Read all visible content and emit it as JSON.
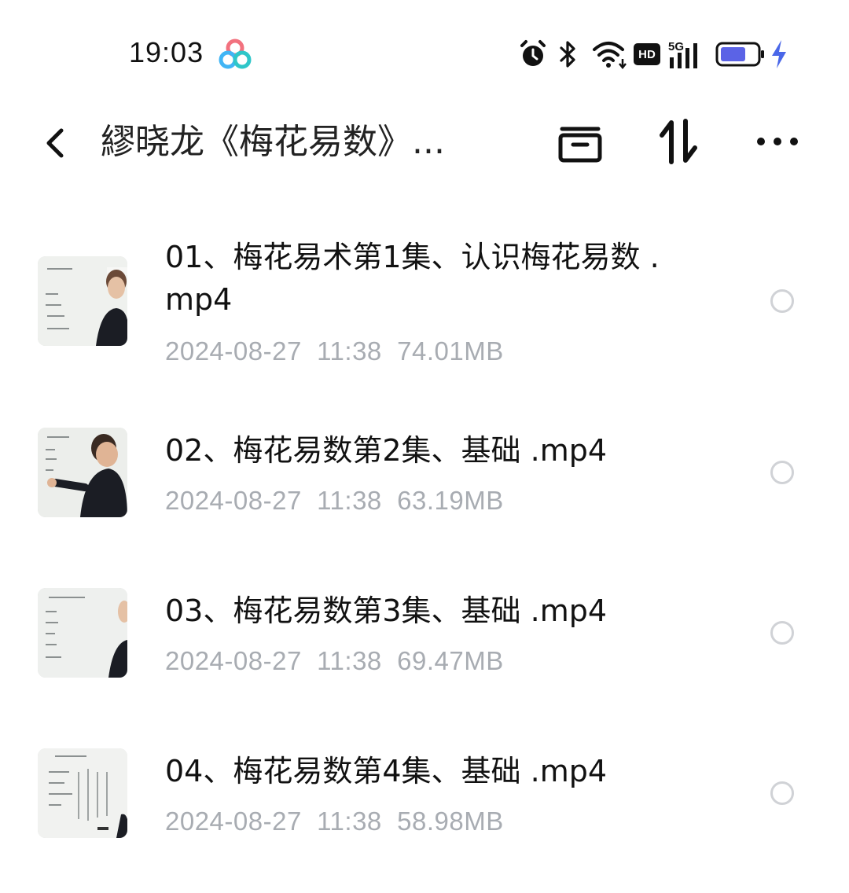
{
  "status_bar": {
    "time": "19:03",
    "hd_label": "HD",
    "network_label": "5G",
    "battery_level": 0.7,
    "icons": [
      "baidu-netdisk-logo",
      "alarm-icon",
      "bluetooth-icon",
      "wifi-icon",
      "hd-icon",
      "signal-5g-icon",
      "battery-icon",
      "charging-icon"
    ]
  },
  "header": {
    "title": "繆晓龙《梅花易数》...",
    "icons": [
      "back-chevron-icon",
      "archive-icon",
      "sort-icon",
      "more-icon"
    ]
  },
  "files": [
    {
      "name": "01、梅花易术第1集、认识梅花易数 .mp4",
      "date": "2024-08-27",
      "time": "11:38",
      "size": "74.01MB",
      "selected": false
    },
    {
      "name": "02、梅花易数第2集、基础 .mp4",
      "date": "2024-08-27",
      "time": "11:38",
      "size": "63.19MB",
      "selected": false
    },
    {
      "name": "03、梅花易数第3集、基础 .mp4",
      "date": "2024-08-27",
      "time": "11:38",
      "size": "69.47MB",
      "selected": false
    },
    {
      "name": "04、梅花易数第4集、基础 .mp4",
      "date": "2024-08-27",
      "time": "11:38",
      "size": "58.98MB",
      "selected": false
    }
  ],
  "colors": {
    "meta_text": "#a8acb2",
    "battery_fill": "#5b63e6",
    "charging": "#4a67e8",
    "radio_border": "#d0d2d6"
  }
}
